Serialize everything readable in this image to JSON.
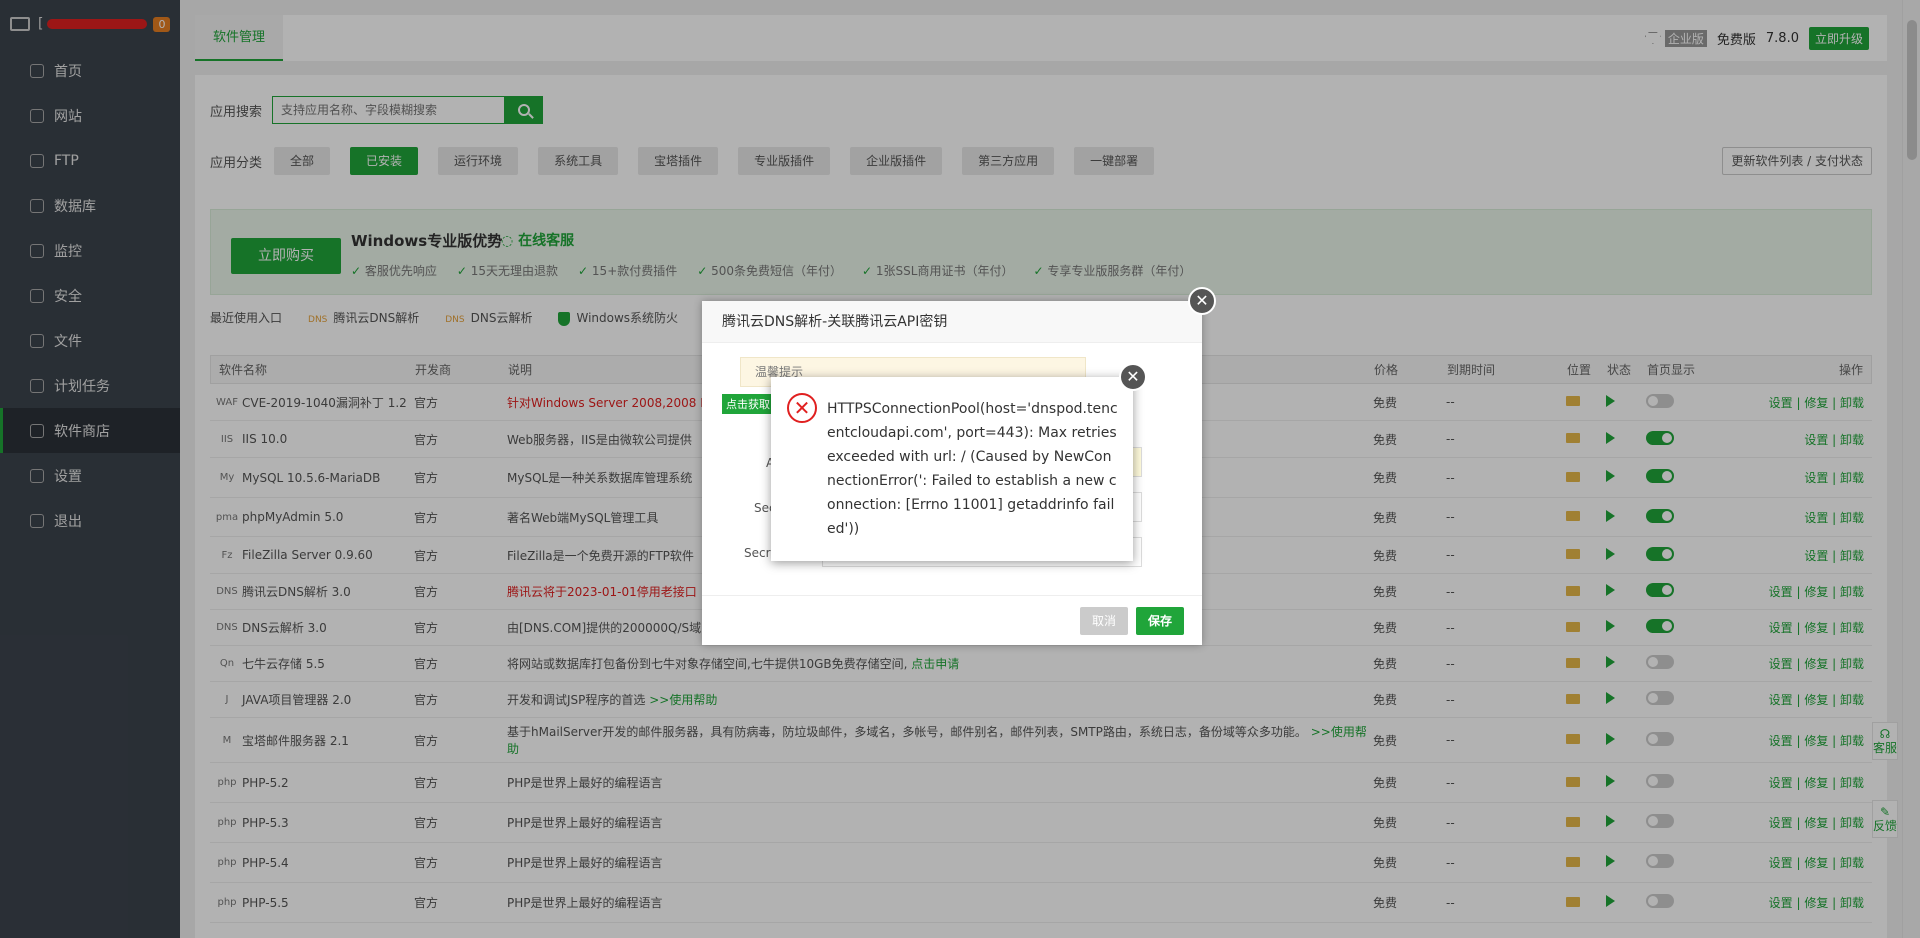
{
  "sidebar": {
    "host": "[",
    "badge": "0",
    "items": [
      {
        "label": "首页",
        "icon": "home-icon"
      },
      {
        "label": "网站",
        "icon": "globe-icon"
      },
      {
        "label": "FTP",
        "icon": "ftp-icon"
      },
      {
        "label": "数据库",
        "icon": "database-icon"
      },
      {
        "label": "监控",
        "icon": "monitor-icon"
      },
      {
        "label": "安全",
        "icon": "shield-icon"
      },
      {
        "label": "文件",
        "icon": "folder-icon"
      },
      {
        "label": "计划任务",
        "icon": "clock-icon"
      },
      {
        "label": "软件商店",
        "icon": "store-icon"
      },
      {
        "label": "设置",
        "icon": "gear-icon"
      },
      {
        "label": "退出",
        "icon": "logout-icon"
      }
    ]
  },
  "topbar": {
    "tab": "软件管理",
    "ent": "企业版",
    "edition": "免费版",
    "version": "7.8.0",
    "upgrade": "立即升级"
  },
  "search": {
    "label": "应用搜索",
    "placeholder": "支持应用名称、字段模糊搜索"
  },
  "categories": {
    "label": "应用分类",
    "items": [
      "全部",
      "已安装",
      "运行环境",
      "系统工具",
      "宝塔插件",
      "专业版插件",
      "企业版插件",
      "第三方应用",
      "一键部署"
    ],
    "active": "已安装",
    "update": "更新软件列表 / 支付状态"
  },
  "promo": {
    "buy": "立即购买",
    "title": "Windows专业版优势",
    "cs": "在线客服",
    "features": [
      "客服优先响应",
      "15天无理由退款",
      "15+款付费插件",
      "500条免费短信（年付）",
      "1张SSL商用证书（年付）",
      "专享专业版服务群（年付）"
    ]
  },
  "recent": {
    "label": "最近使用入口",
    "items": [
      "腾讯云DNS解析",
      "DNS云解析",
      "Windows系统防火"
    ]
  },
  "table": {
    "headers": {
      "name": "软件名称",
      "dev": "开发商",
      "desc": "说明",
      "price": "价格",
      "exp": "到期时间",
      "pos": "位置",
      "status": "状态",
      "home": "首页显示",
      "op": "操作"
    },
    "rows": [
      {
        "name": "CVE-2019-1040漏洞补丁 1.2",
        "icon": "WAF",
        "dev": "官方",
        "desc": "针对Windows Server 2008,2008 R",
        "desc_color": "red",
        "price": "免费",
        "exp": "--",
        "home": "off",
        "op": "设置 | 修复 | 卸载"
      },
      {
        "name": "IIS 10.0",
        "icon": "IIS",
        "dev": "官方",
        "desc": "Web服务器，IIS是由微软公司提供",
        "price": "免费",
        "exp": "--",
        "home": "on",
        "op": "设置 | 卸载"
      },
      {
        "name": "MySQL 10.5.6-MariaDB",
        "icon": "My",
        "dev": "官方",
        "desc": "MySQL是一种关系数据库管理系统",
        "price": "免费",
        "exp": "--",
        "home": "on",
        "op": "设置 | 卸载"
      },
      {
        "name": "phpMyAdmin 5.0",
        "icon": "pma",
        "dev": "官方",
        "desc": "著名Web端MySQL管理工具",
        "price": "免费",
        "exp": "--",
        "home": "on",
        "op": "设置 | 卸载"
      },
      {
        "name": "FileZilla Server 0.9.60",
        "icon": "Fz",
        "dev": "官方",
        "desc": "FileZilla是一个免费开源的FTP软件",
        "price": "免费",
        "exp": "--",
        "home": "on",
        "op": "设置 | 卸载"
      },
      {
        "name": "腾讯云DNS解析 3.0",
        "icon": "DNS",
        "dev": "官方",
        "desc": "腾讯云将于2023-01-01停用老接口",
        "desc_color": "red",
        "price": "免费",
        "exp": "--",
        "home": "on",
        "op": "设置 | 修复 | 卸载"
      },
      {
        "name": "DNS云解析 3.0",
        "icon": "DNS",
        "dev": "官方",
        "desc": "由[DNS.COM]提供的200000Q/S域",
        "price": "免费",
        "exp": "--",
        "home": "on",
        "op": "设置 | 修复 | 卸载"
      },
      {
        "name": "七牛云存储 5.5",
        "icon": "Qn",
        "dev": "官方",
        "desc": "将网站或数据库打包备份到七牛对象存储空间,七牛提供10GB免费存储空间,",
        "desc_link": "点击申请",
        "price": "免费",
        "exp": "--",
        "home": "off",
        "op": "设置 | 修复 | 卸载"
      },
      {
        "name": "JAVA项目管理器 2.0",
        "icon": "J",
        "dev": "官方",
        "desc": "开发和调试JSP程序的首选",
        "desc_link": ">>使用帮助",
        "price": "免费",
        "exp": "--",
        "home": "off",
        "op": "设置 | 修复 | 卸载"
      },
      {
        "name": "宝塔邮件服务器 2.1",
        "icon": "M",
        "dev": "官方",
        "desc": "基于hMailServer开发的邮件服务器，具有防病毒，防垃圾邮件，多域名，多帐号，邮件别名，邮件列表，SMTP路由，系统日志，备份域等众多功能。",
        "desc_link": ">>使用帮助",
        "price": "免费",
        "exp": "--",
        "home": "off",
        "op": "设置 | 修复 | 卸载",
        "tall": true
      },
      {
        "name": "PHP-5.2",
        "icon": "php",
        "dev": "官方",
        "desc": "PHP是世界上最好的编程语言",
        "price": "免费",
        "exp": "--",
        "home": "off",
        "op": "设置 | 修复 | 卸载"
      },
      {
        "name": "PHP-5.3",
        "icon": "php",
        "dev": "官方",
        "desc": "PHP是世界上最好的编程语言",
        "price": "免费",
        "exp": "--",
        "home": "off",
        "op": "设置 | 修复 | 卸载"
      },
      {
        "name": "PHP-5.4",
        "icon": "php",
        "dev": "官方",
        "desc": "PHP是世界上最好的编程语言",
        "price": "免费",
        "exp": "--",
        "home": "off",
        "op": "设置 | 修复 | 卸载"
      },
      {
        "name": "PHP-5.5",
        "icon": "php",
        "dev": "官方",
        "desc": "PHP是世界上最好的编程语言",
        "price": "免费",
        "exp": "--",
        "home": "off",
        "op": "设置 | 修复 | 卸载"
      }
    ]
  },
  "dialog": {
    "title": "腾讯云DNS解析-关联腾讯云API密钥",
    "tip": "温馨提示",
    "get": "点击获取",
    "labels": [
      "A",
      "Sec",
      "Secr"
    ],
    "cancel": "取消",
    "save": "保存"
  },
  "error": {
    "message": "HTTPSConnectionPool(host='dnspod.tencentcloudapi.com', port=443): Max retries exceeded with url: / (Caused by NewConnectionError(': Failed to establish a new connection: [Errno 11001] getaddrinfo failed'))"
  },
  "float": {
    "service": "客服",
    "feedback": "反馈"
  },
  "colors": {
    "brand": "#20a53a",
    "sidebar": "#3c444d",
    "error": "#e02020"
  }
}
